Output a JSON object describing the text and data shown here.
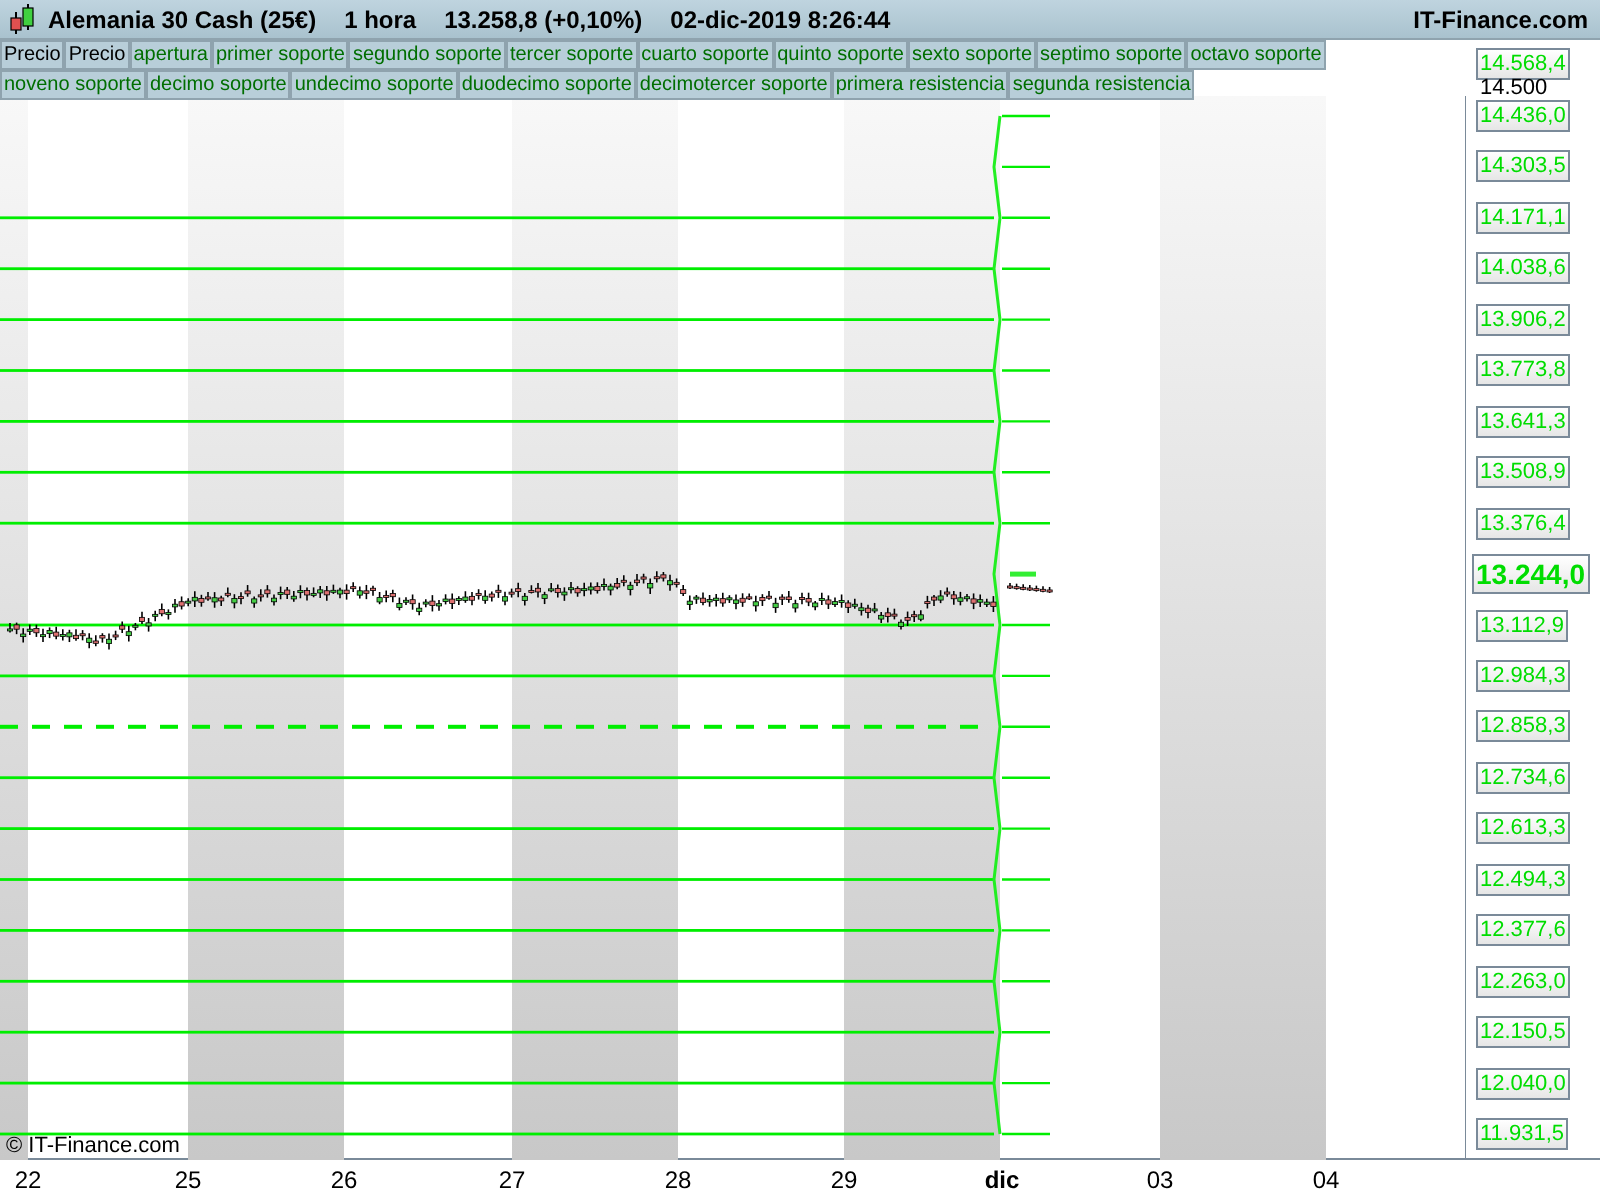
{
  "header": {
    "title": "Alemania 30 Cash (25€)",
    "timeframe": "1 hora",
    "price": "13.258,8 (+0,10%)",
    "datetime": "02-dic-2019 8:26:44",
    "brand": "IT-Finance.com"
  },
  "legend": [
    {
      "label": "Precio",
      "kind": "price"
    },
    {
      "label": "Precio",
      "kind": "price"
    },
    {
      "label": "apertura",
      "kind": "level"
    },
    {
      "label": "primer soporte",
      "kind": "level"
    },
    {
      "label": "segundo soporte",
      "kind": "level"
    },
    {
      "label": "tercer soporte",
      "kind": "level"
    },
    {
      "label": "cuarto soporte",
      "kind": "level"
    },
    {
      "label": "quinto soporte",
      "kind": "level"
    },
    {
      "label": "sexto soporte",
      "kind": "level"
    },
    {
      "label": "septimo soporte",
      "kind": "level"
    },
    {
      "label": "octavo soporte",
      "kind": "level"
    },
    {
      "label": "noveno soporte",
      "kind": "level"
    },
    {
      "label": "decimo soporte",
      "kind": "level"
    },
    {
      "label": "undecimo soporte",
      "kind": "level"
    },
    {
      "label": "duodecimo soporte",
      "kind": "level"
    },
    {
      "label": "decimotercer soporte",
      "kind": "level"
    },
    {
      "label": "primera resistencia",
      "kind": "level"
    },
    {
      "label": "segunda resistencia",
      "kind": "level"
    }
  ],
  "axis_ticks": [
    {
      "label": "14.500"
    }
  ],
  "top_level": {
    "label": "14.568,4"
  },
  "levels": [
    {
      "label": "14.436,0",
      "kind": "level",
      "extended": false
    },
    {
      "label": "14.303,5",
      "kind": "level",
      "extended": false
    },
    {
      "label": "14.171,1",
      "kind": "level",
      "extended": true
    },
    {
      "label": "14.038,6",
      "kind": "level",
      "extended": true
    },
    {
      "label": "13.906,2",
      "kind": "level",
      "extended": true
    },
    {
      "label": "13.773,8",
      "kind": "level",
      "extended": true
    },
    {
      "label": "13.641,3",
      "kind": "level",
      "extended": true
    },
    {
      "label": "13.508,9",
      "kind": "level",
      "extended": true
    },
    {
      "label": "13.376,4",
      "kind": "level",
      "extended": true
    },
    {
      "label": "13.244,0",
      "kind": "current",
      "extended": false
    },
    {
      "label": "13.112,9",
      "kind": "level",
      "extended": true
    },
    {
      "label": "12.984,3",
      "kind": "level",
      "extended": true
    },
    {
      "label": "12.858,3",
      "kind": "dashed",
      "extended": true
    },
    {
      "label": "12.734,6",
      "kind": "level",
      "extended": true
    },
    {
      "label": "12.613,3",
      "kind": "level",
      "extended": true
    },
    {
      "label": "12.494,3",
      "kind": "level",
      "extended": true
    },
    {
      "label": "12.377,6",
      "kind": "level",
      "extended": true
    },
    {
      "label": "12.263,0",
      "kind": "level",
      "extended": true
    },
    {
      "label": "12.150,5",
      "kind": "level",
      "extended": true
    },
    {
      "label": "12.040,0",
      "kind": "level",
      "extended": true
    },
    {
      "label": "11.931,5",
      "kind": "level",
      "extended": true
    }
  ],
  "copyright": "© IT-Finance.com",
  "x_labels": [
    {
      "label": "22",
      "kind": "day"
    },
    {
      "label": "25",
      "kind": "day"
    },
    {
      "label": "26",
      "kind": "day"
    },
    {
      "label": "27",
      "kind": "day"
    },
    {
      "label": "28",
      "kind": "day"
    },
    {
      "label": "29",
      "kind": "day"
    },
    {
      "label": "dic",
      "kind": "month"
    },
    {
      "label": "03",
      "kind": "day"
    },
    {
      "label": "04",
      "kind": "day"
    }
  ]
}
